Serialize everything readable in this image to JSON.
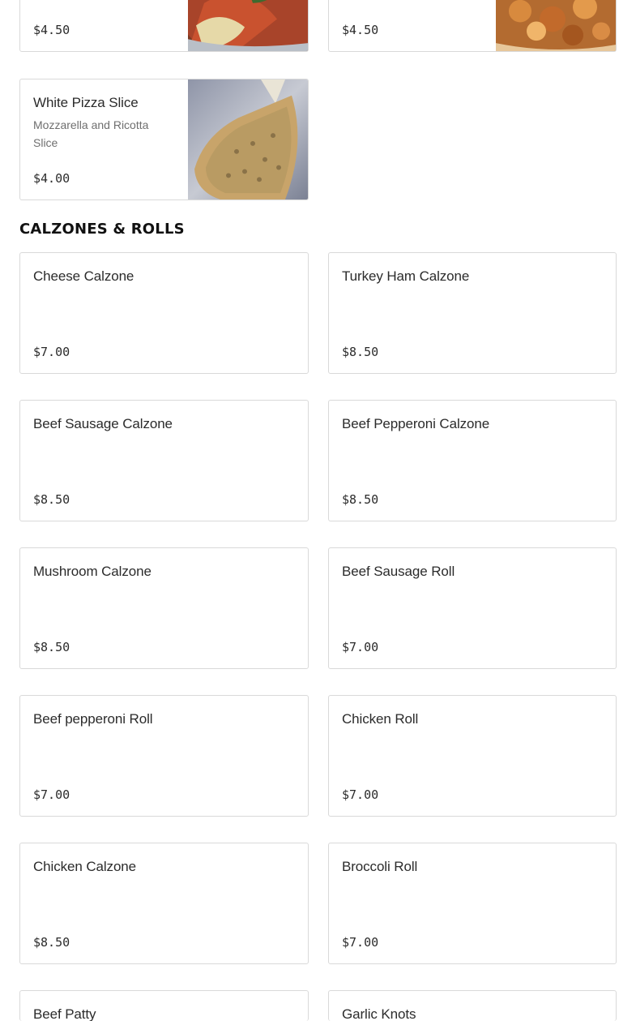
{
  "top_items": [
    {
      "price": "$4.50"
    },
    {
      "price": "$4.50"
    }
  ],
  "featured_item": {
    "name": "White Pizza Slice",
    "description": "Mozzarella and Ricotta Slice",
    "price": "$4.00"
  },
  "section": {
    "title": "CALZONES & ROLLS",
    "items": [
      {
        "name": "Cheese Calzone",
        "price": "$7.00"
      },
      {
        "name": "Turkey Ham Calzone",
        "price": "$8.50"
      },
      {
        "name": "Beef Sausage Calzone",
        "price": "$8.50"
      },
      {
        "name": "Beef Pepperoni Calzone",
        "price": "$8.50"
      },
      {
        "name": "Mushroom Calzone",
        "price": "$8.50"
      },
      {
        "name": "Beef Sausage Roll",
        "price": "$7.00"
      },
      {
        "name": "Beef pepperoni Roll",
        "price": "$7.00"
      },
      {
        "name": "Chicken Roll",
        "price": "$7.00"
      },
      {
        "name": "Chicken Calzone",
        "price": "$8.50"
      },
      {
        "name": "Broccoli Roll",
        "price": "$7.00"
      },
      {
        "name": "Beef Patty",
        "price": ""
      },
      {
        "name": "Garlic Knots",
        "price": ""
      }
    ]
  }
}
